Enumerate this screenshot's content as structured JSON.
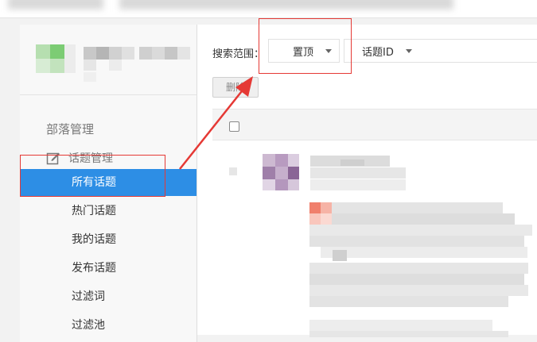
{
  "sidebar": {
    "section_title": "部落管理",
    "group_label": "话题管理",
    "items": [
      {
        "label": "所有话题",
        "active": true
      },
      {
        "label": "热门话题",
        "active": false
      },
      {
        "label": "我的话题",
        "active": false
      },
      {
        "label": "发布话题",
        "active": false
      },
      {
        "label": "过滤词",
        "active": false
      },
      {
        "label": "过滤池",
        "active": false
      }
    ]
  },
  "toolbar": {
    "search_label": "搜索范围：",
    "scope_value": "置顶",
    "field_value": "话题ID",
    "delete_label": "删除"
  },
  "colors": {
    "accent": "#2d8ee5",
    "annotation": "#e53935"
  }
}
